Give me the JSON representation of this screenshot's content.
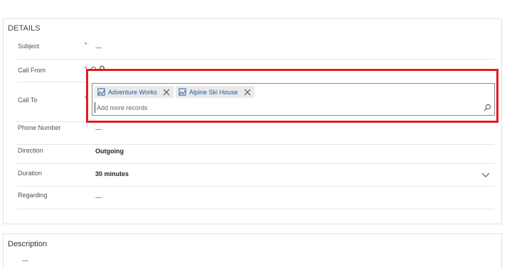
{
  "details": {
    "title": "DETAILS",
    "subject": {
      "label": "Subject",
      "required": "*",
      "value": "---"
    },
    "call_from": {
      "label": "Call From",
      "required": "*"
    },
    "call_to": {
      "label": "Call To",
      "required": "*"
    },
    "phone_number": {
      "label": "Phone Number",
      "value": "---"
    },
    "direction": {
      "label": "Direction",
      "value": "Outgoing"
    },
    "duration": {
      "label": "Duration",
      "value": "30 minutes"
    },
    "regarding": {
      "label": "Regarding",
      "value": "---"
    }
  },
  "lookup_popup": {
    "tags": [
      {
        "label": "Adventure Works",
        "icon": "account-icon"
      },
      {
        "label": "Alpine Ski House",
        "icon": "account-icon"
      }
    ],
    "input_placeholder": "Add more records",
    "input_value": ""
  },
  "description": {
    "title": "Description",
    "value": "---"
  },
  "colors": {
    "highlight": "#e31b23",
    "tag_text": "#1d5a9b",
    "required": "#d13438"
  }
}
